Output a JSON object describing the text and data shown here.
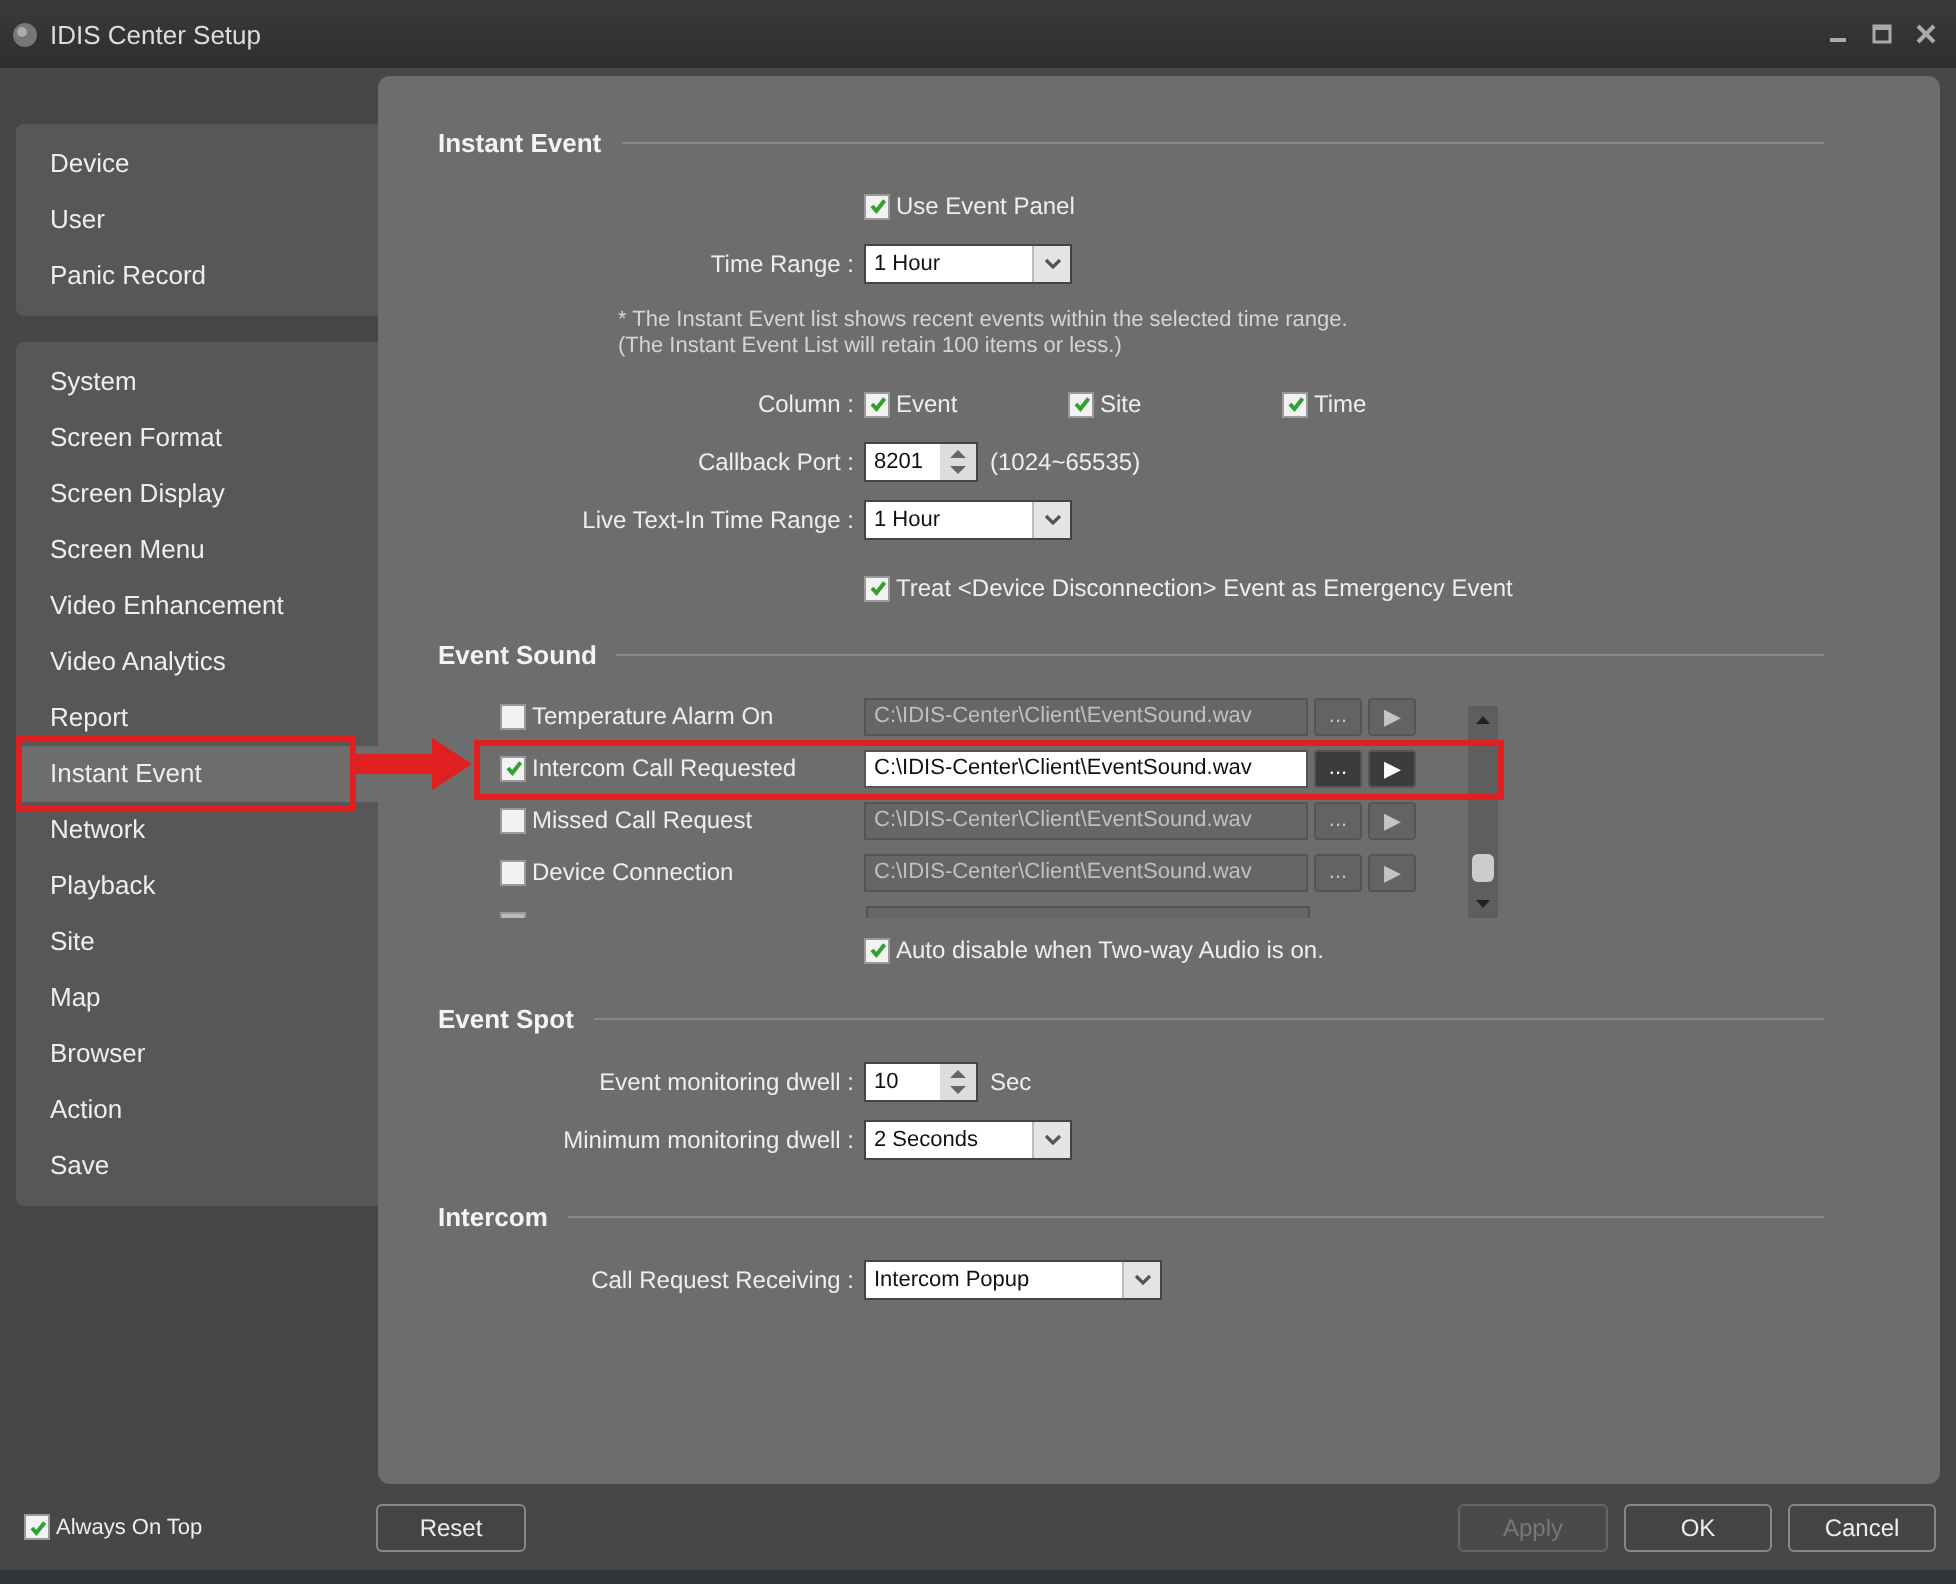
{
  "window": {
    "title": "IDIS Center Setup"
  },
  "sidebar": {
    "groups": [
      [
        {
          "label": "Device",
          "selected": false
        },
        {
          "label": "User",
          "selected": false
        },
        {
          "label": "Panic Record",
          "selected": false
        }
      ],
      [
        {
          "label": "System",
          "selected": false
        },
        {
          "label": "Screen Format",
          "selected": false
        },
        {
          "label": "Screen Display",
          "selected": false
        },
        {
          "label": "Screen Menu",
          "selected": false
        },
        {
          "label": "Video Enhancement",
          "selected": false
        },
        {
          "label": "Video Analytics",
          "selected": false
        },
        {
          "label": "Report",
          "selected": false
        },
        {
          "label": "Instant Event",
          "selected": true
        },
        {
          "label": "Network",
          "selected": false
        },
        {
          "label": "Playback",
          "selected": false
        },
        {
          "label": "Site",
          "selected": false
        },
        {
          "label": "Map",
          "selected": false
        },
        {
          "label": "Browser",
          "selected": false
        },
        {
          "label": "Action",
          "selected": false
        },
        {
          "label": "Save",
          "selected": false
        }
      ]
    ]
  },
  "instant_event": {
    "title": "Instant Event",
    "use_event_panel": {
      "label": "Use Event Panel",
      "checked": true
    },
    "time_range": {
      "label": "Time Range :",
      "value": "1 Hour"
    },
    "note": [
      "* The Instant Event list shows recent events within the selected time range.",
      "(The Instant Event List will retain 100 items or less.)"
    ],
    "column": {
      "label": "Column :",
      "options": [
        {
          "label": "Event",
          "checked": true
        },
        {
          "label": "Site",
          "checked": true
        },
        {
          "label": "Time",
          "checked": true
        }
      ]
    },
    "callback_port": {
      "label": "Callback Port :",
      "value": "8201",
      "range": "(1024~65535)"
    },
    "live_text_in": {
      "label": "Live Text-In Time Range :",
      "value": "1 Hour"
    },
    "treat_disconnection": {
      "label": "Treat <Device Disconnection> Event as Emergency Event",
      "checked": true
    }
  },
  "event_sound": {
    "title": "Event Sound",
    "rows": [
      {
        "label": "Temperature Alarm On",
        "checked": false,
        "path": "C:\\IDIS-Center\\Client\\EventSound.wav",
        "browse": "...",
        "play": "▶"
      },
      {
        "label": "Intercom Call Requested",
        "checked": true,
        "path": "C:\\IDIS-Center\\Client\\EventSound.wav",
        "browse": "...",
        "play": "▶"
      },
      {
        "label": "Missed Call Request",
        "checked": false,
        "path": "C:\\IDIS-Center\\Client\\EventSound.wav",
        "browse": "...",
        "play": "▶"
      },
      {
        "label": "Device Connection",
        "checked": false,
        "path": "C:\\IDIS-Center\\Client\\EventSound.wav",
        "browse": "...",
        "play": "▶"
      }
    ],
    "auto_disable": {
      "label": "Auto disable when Two-way Audio is on.",
      "checked": true
    }
  },
  "event_spot": {
    "title": "Event Spot",
    "dwell": {
      "label": "Event monitoring dwell :",
      "value": "10",
      "unit": "Sec"
    },
    "min_dwell": {
      "label": "Minimum monitoring dwell :",
      "value": "2 Seconds"
    }
  },
  "intercom": {
    "title": "Intercom",
    "call_request": {
      "label": "Call Request Receiving :",
      "value": "Intercom Popup"
    }
  },
  "always_on_top": {
    "label": "Always On Top",
    "checked": true
  },
  "buttons": [
    {
      "label": "Reset",
      "disabled": false
    },
    {
      "label": "Apply",
      "disabled": true
    },
    {
      "label": "OK",
      "disabled": false
    },
    {
      "label": "Cancel",
      "disabled": false
    }
  ]
}
